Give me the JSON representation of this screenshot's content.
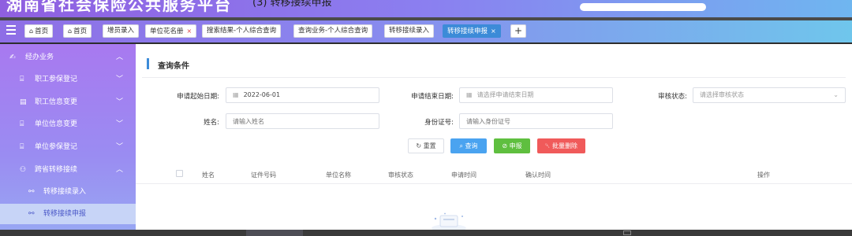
{
  "header": {
    "title": "湖南省社会保险公共服务平台",
    "subtitle": "(3) 转移接续申报"
  },
  "tabs": [
    {
      "label": "首页",
      "home": true,
      "closable": false
    },
    {
      "label": "首页",
      "home": true,
      "closable": false
    },
    {
      "label": "增员录入",
      "home": false,
      "closable": false
    },
    {
      "label": "单位花名册",
      "home": false,
      "closable": true
    },
    {
      "label": "搜索结果-个人综合查询",
      "home": false,
      "closable": false
    },
    {
      "label": "查询业务-个人综合查询",
      "home": false,
      "closable": false
    },
    {
      "label": "转移接续录入",
      "home": false,
      "closable": false
    },
    {
      "label": "转移接续申报",
      "home": false,
      "closable": true,
      "active": true
    }
  ],
  "tab_add_label": "+",
  "tab_close_glyph": "×",
  "home_glyph": "⌂",
  "sidebar": {
    "items": [
      {
        "label": "经办业务",
        "icon": "handshake-icon",
        "glyph": "✍",
        "chevron": "︿",
        "level": 0
      },
      {
        "label": "职工参保登记",
        "icon": "document-icon",
        "glyph": "⌸",
        "chevron": "﹀",
        "level": 1
      },
      {
        "label": "职工信息变更",
        "icon": "id-card-icon",
        "glyph": "▤",
        "chevron": "﹀",
        "level": 1
      },
      {
        "label": "单位信息变更",
        "icon": "document-icon",
        "glyph": "⌸",
        "chevron": "﹀",
        "level": 1
      },
      {
        "label": "单位参保登记",
        "icon": "document-icon",
        "glyph": "⌸",
        "chevron": "﹀",
        "level": 1
      },
      {
        "label": "跨省转移接续",
        "icon": "user-icon",
        "glyph": "⚇",
        "chevron": "︿",
        "level": 1
      },
      {
        "label": "转移接续录入",
        "icon": "link-icon",
        "glyph": "⚯",
        "chevron": "",
        "level": 2
      },
      {
        "label": "转移接续申报",
        "icon": "link-icon",
        "glyph": "⚯",
        "chevron": "",
        "level": 2,
        "active": true
      }
    ]
  },
  "main": {
    "section_title": "查询条件",
    "form": {
      "start_date_label": "申请起始日期:",
      "start_date_value": "2022-06-01",
      "end_date_label": "申请结束日期:",
      "end_date_placeholder": "请选择申请结束日期",
      "status_label": "审核状态:",
      "status_placeholder": "请选择审核状态",
      "name_label": "姓名:",
      "name_placeholder": "请输入姓名",
      "idno_label": "身份证号:",
      "idno_placeholder": "请输入身份证号",
      "calendar_glyph": "▦",
      "dropdown_glyph": "⌄"
    },
    "buttons": {
      "reset": "↻ 重置",
      "query": "⌕ 查询",
      "declare": "⊘ 申报",
      "delete": "␡ 批量删除"
    },
    "table": {
      "columns": [
        "姓名",
        "证件号码",
        "单位名称",
        "审核状态",
        "申请时间",
        "确认时间",
        "操作"
      ]
    }
  },
  "colors": {
    "accent": "#3c8bd8",
    "query": "#4aa3f0",
    "declare": "#5fbf3f",
    "delete": "#f05a5a",
    "sidebar_active_bg": "#c7d4f7"
  }
}
